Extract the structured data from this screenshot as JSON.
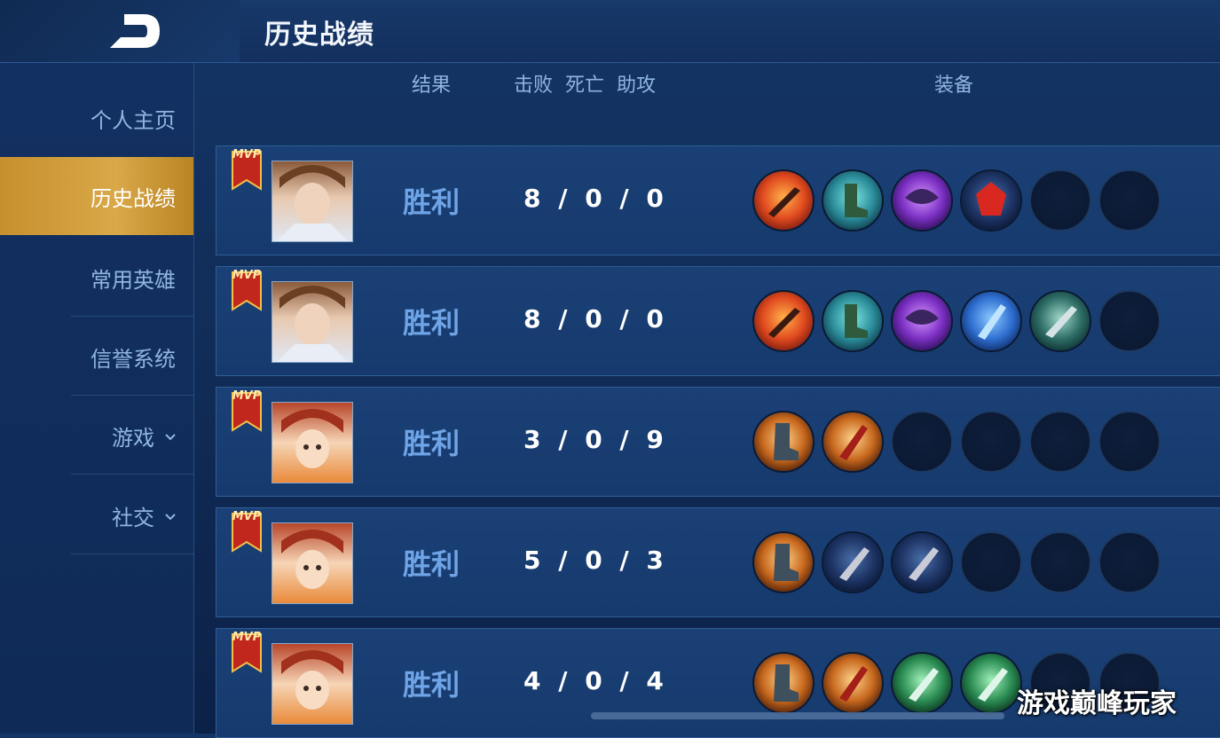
{
  "header": {
    "title": "历史战绩",
    "back_icon": "back-arrow-icon"
  },
  "sidebar": {
    "items": [
      {
        "label": "个人主页"
      },
      {
        "label": "历史战绩"
      },
      {
        "label": "常用英雄"
      },
      {
        "label": "信誉系统"
      },
      {
        "label": "游戏"
      },
      {
        "label": "社交"
      }
    ]
  },
  "columns": {
    "result": "结果",
    "kills": "击败",
    "deaths": "死亡",
    "assists": "助攻",
    "equipment": "装备"
  },
  "matches": [
    {
      "mvp": "MVP",
      "result": "胜利",
      "kda": "8 / 0 / 0",
      "hero": "hero-portrait-brown-hair"
    },
    {
      "mvp": "MVP",
      "result": "胜利",
      "kda": "8 / 0 / 0",
      "hero": "hero-portrait-brown-hair"
    },
    {
      "mvp": "MVP",
      "result": "胜利",
      "kda": "3 / 0 / 9",
      "hero": "hero-portrait-red-hair"
    },
    {
      "mvp": "MVP",
      "result": "胜利",
      "kda": "5 / 0 / 3",
      "hero": "hero-portrait-red-hair"
    },
    {
      "mvp": "MVP",
      "result": "胜利",
      "kda": "4 / 0 / 4",
      "hero": "hero-portrait-red-hair"
    }
  ],
  "watermark": "游戏巅峰玩家",
  "colors": {
    "accent_gold": "#d9a848",
    "result_blue": "#6fa4e6",
    "panel_blue": "#1a4076"
  }
}
